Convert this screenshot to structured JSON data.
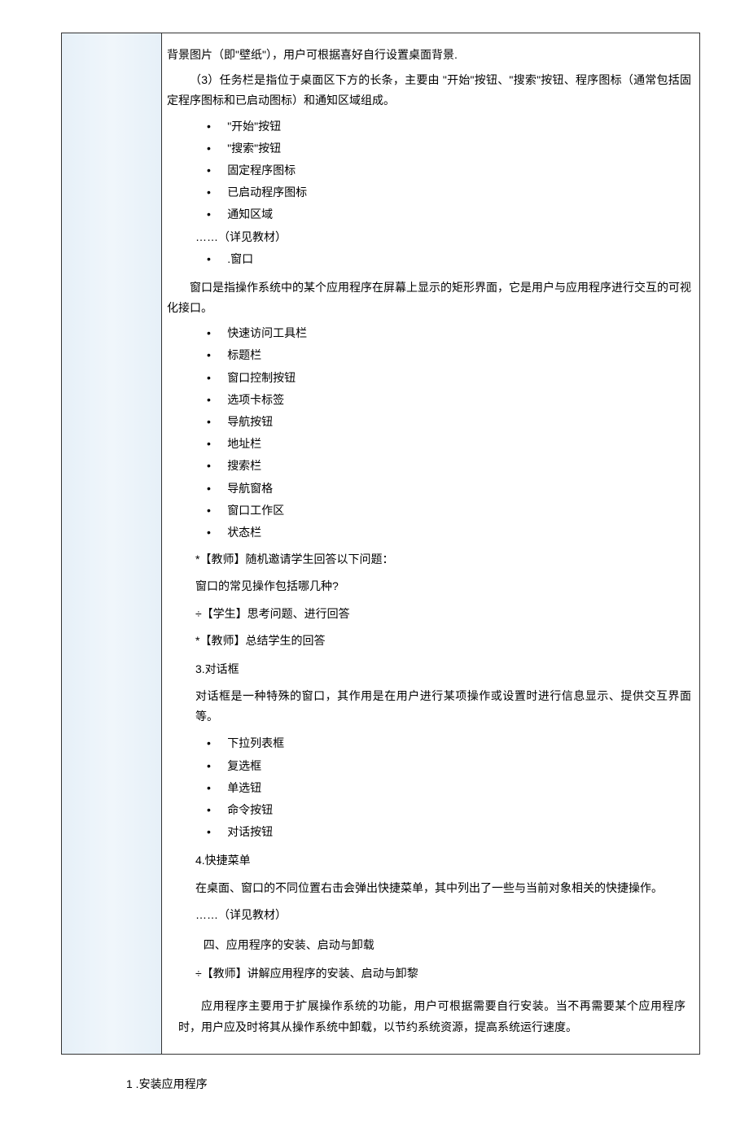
{
  "top": {
    "line1": "背景图片（即\"壁纸\"），用户可根据喜好自行设置桌面背景.",
    "line2": "（3）任务栏是指位于桌面区下方的长条，主要由 \"开始\"按钮、\"搜索\"按钮、程序图标（通常包括固定程序图标和已启动图标）和通知区域组成。"
  },
  "list1": {
    "items": [
      "\"开始\"按钮",
      "\"搜索\"按钮",
      "固定程序图标",
      "已启动程序图标",
      "通知区域"
    ]
  },
  "ellipsis1": "……（详见教材）",
  "windowBullet": ".窗口",
  "windowDesc": "窗口是指操作系统中的某个应用程序在屏幕上显示的矩形界面，它是用户与应用程序进行交互的可视化接口。",
  "list2": {
    "items": [
      "快速访问工具栏",
      "标题栏",
      "窗口控制按钮",
      "选项卡标签",
      "导航按钮",
      "地址栏",
      "搜索栏",
      "导航窗格",
      "窗口工作区",
      "状态栏"
    ]
  },
  "qa": {
    "teacher1": "*【教师】随机邀请学生回答以下问题：",
    "question": "窗口的常见操作包括哪几种?",
    "student": "÷【学生】思考问题、进行回答",
    "teacher2": "*【教师】总结学生的回答"
  },
  "dialog": {
    "num": "3.对话框",
    "desc": "对话框是一种特殊的窗口，其作用是在用户进行某项操作或设置时进行信息显示、提供交互界面等。",
    "items": [
      "下拉列表框",
      "复选框",
      "单选钮",
      "命令按钮",
      "对话按钮"
    ]
  },
  "menu": {
    "num": "4.快捷菜单",
    "desc": "在桌面、窗口的不同位置右击会弹出快捷菜单，其中列出了一些与当前对象相关的快捷操作。",
    "ellipsis": "……（详见教材）"
  },
  "section4": {
    "heading": "四、应用程序的安装、启动与卸载",
    "teacher": "÷【教师】讲解应用程序的安装、启动与卸",
    "teacherSuffix": "黎",
    "para": "应用程序主要用于扩展操作系统的功能，用户可根据需要自行安装。当不再需要某个应用程序时，用户应及时将其从操作系统中卸载，以节约系统资源，提高系统运行速度。"
  },
  "footer": "1  .安装应用程序"
}
